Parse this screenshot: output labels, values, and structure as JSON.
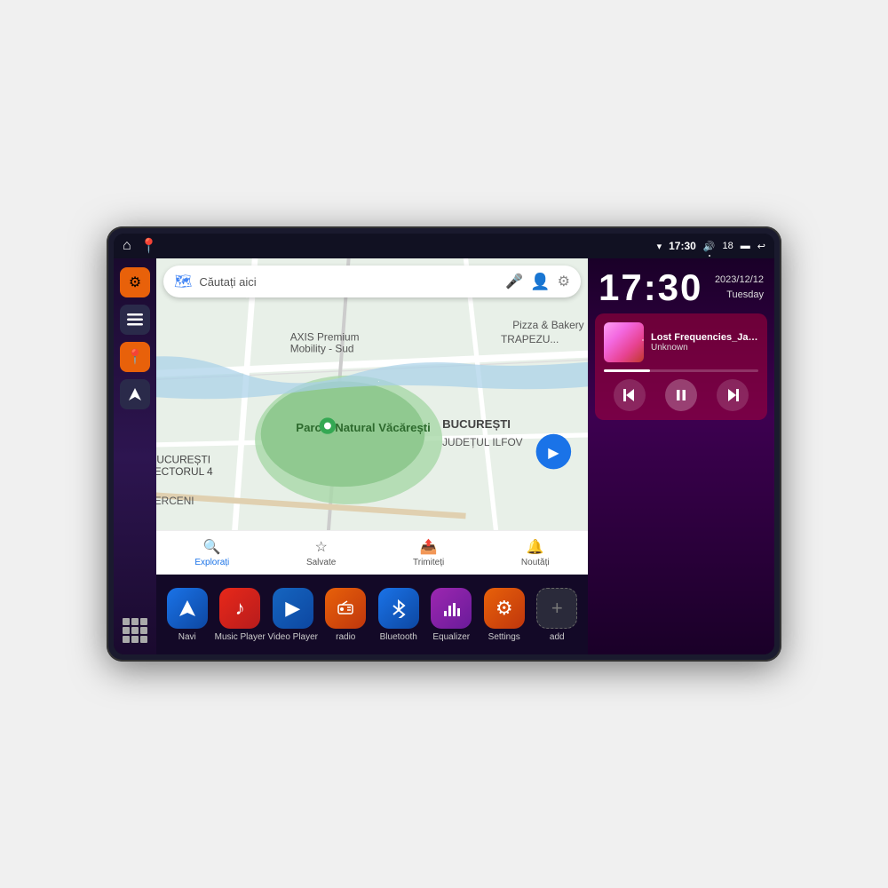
{
  "device": {
    "status_bar": {
      "left_icons": [
        "⌂",
        "📍"
      ],
      "wifi_icon": "▾",
      "time": "17:30",
      "volume_icon": "🔊",
      "battery_level": "18",
      "battery_icon": "▬",
      "back_icon": "↩"
    },
    "clock": {
      "time": "17:30",
      "date": "2023/12/12",
      "day": "Tuesday"
    },
    "music": {
      "title": "Lost Frequencies_Janie...",
      "artist": "Unknown",
      "progress": 30
    },
    "map": {
      "search_placeholder": "Căutați aici",
      "tabs": [
        {
          "label": "Explorați",
          "icon": "🔍"
        },
        {
          "label": "Salvate",
          "icon": "☆"
        },
        {
          "label": "Trimiteți",
          "icon": "📤"
        },
        {
          "label": "Noutăți",
          "icon": "🔔"
        }
      ]
    },
    "sidebar": {
      "items": [
        {
          "icon": "⚙",
          "style": "orange",
          "label": "Settings"
        },
        {
          "icon": "≡",
          "style": "dark",
          "label": "Menu"
        },
        {
          "icon": "📍",
          "style": "orange",
          "label": "Navigation"
        },
        {
          "icon": "▲",
          "style": "dark",
          "label": "Arrow"
        }
      ]
    },
    "apps": [
      {
        "label": "Navi",
        "icon": "▲",
        "color": "#1a73e8",
        "bg": "#1565c0"
      },
      {
        "label": "Music Player",
        "icon": "♪",
        "color": "#fff",
        "bg": "#e8281a"
      },
      {
        "label": "Video Player",
        "icon": "▶",
        "color": "#fff",
        "bg": "#1565c0"
      },
      {
        "label": "radio",
        "icon": "📻",
        "color": "#fff",
        "bg": "#e8610a"
      },
      {
        "label": "Bluetooth",
        "icon": "⚡",
        "color": "#fff",
        "bg": "#1a73e8"
      },
      {
        "label": "Equalizer",
        "icon": "≣",
        "color": "#fff",
        "bg": "#9c27b0"
      },
      {
        "label": "Settings",
        "icon": "⚙",
        "color": "#fff",
        "bg": "#e8610a"
      },
      {
        "label": "add",
        "icon": "+",
        "color": "#aaa",
        "bg": "#333"
      }
    ]
  }
}
